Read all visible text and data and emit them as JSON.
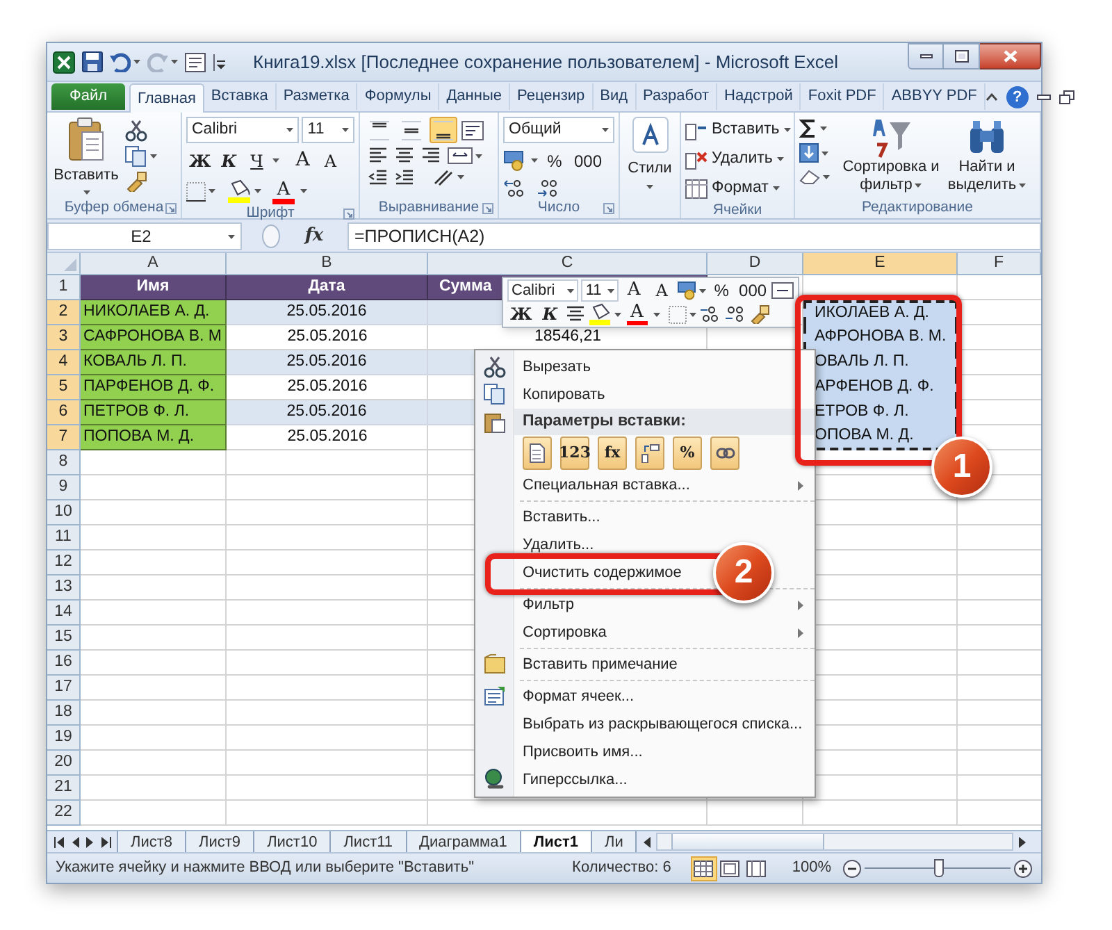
{
  "window": {
    "title": "Книга19.xlsx [Последнее сохранение пользователем]  -  Microsoft Excel"
  },
  "ribbon_tabs": [
    {
      "label": "Файл",
      "kind": "file",
      "selected": false
    },
    {
      "label": "Главная",
      "kind": "tab",
      "selected": true
    },
    {
      "label": "Вставка",
      "kind": "tab",
      "selected": false
    },
    {
      "label": "Разметка",
      "kind": "tab",
      "selected": false
    },
    {
      "label": "Формулы",
      "kind": "tab",
      "selected": false
    },
    {
      "label": "Данные",
      "kind": "tab",
      "selected": false
    },
    {
      "label": "Рецензир",
      "kind": "tab",
      "selected": false
    },
    {
      "label": "Вид",
      "kind": "tab",
      "selected": false
    },
    {
      "label": "Разработ",
      "kind": "tab",
      "selected": false
    },
    {
      "label": "Надстрой",
      "kind": "tab",
      "selected": false
    },
    {
      "label": "Foxit PDF",
      "kind": "tab",
      "selected": false
    },
    {
      "label": "ABBYY PDF",
      "kind": "tab",
      "selected": false
    }
  ],
  "help": "?",
  "clipboard": {
    "label": "Буфер обмена",
    "paste": "Вставить"
  },
  "font": {
    "label": "Шрифт",
    "name": "Calibri",
    "size": "11",
    "bold": "Ж",
    "italic": "К",
    "underline": "Ч",
    "grow": "A",
    "shrink": "A",
    "font_color": "A"
  },
  "alignment": {
    "label": "Выравнивание",
    "vertical": [
      {
        "selected": false
      },
      {
        "selected": false
      },
      {
        "selected": true
      }
    ]
  },
  "number": {
    "label": "Число",
    "format": "Общий",
    "percent": "%",
    "thousands": "000"
  },
  "styles": {
    "button": "Стили"
  },
  "cells": {
    "label": "Ячейки",
    "items": [
      "Вставить",
      "Удалить",
      "Формат"
    ]
  },
  "editing": {
    "label": "Редактирование",
    "sort": "Сортировка и фильтр",
    "find": "Найти и выделить"
  },
  "formula_bar": {
    "name_box": "E2",
    "fx": "fx",
    "formula": "=ПРОПИСН(A2)"
  },
  "sheet": {
    "columns": [
      {
        "label": "A",
        "selected": false
      },
      {
        "label": "B",
        "selected": false
      },
      {
        "label": "C",
        "selected": false
      },
      {
        "label": "D",
        "selected": false
      },
      {
        "label": "E",
        "selected": true
      },
      {
        "label": "F",
        "selected": false
      }
    ],
    "rows": [
      {
        "number": "1",
        "kind": "header",
        "selected": false,
        "a": "Имя",
        "b": "Дата",
        "c": "Сумма"
      },
      {
        "number": "2",
        "kind": "data",
        "selected": true,
        "a": "НИКОЛАЕВ А. Д.",
        "b": "25.05.2016",
        "e": "ИКОЛАЕВ А. Д."
      },
      {
        "number": "3",
        "kind": "data",
        "selected": true,
        "a": "САФРОНОВА В. М",
        "b": "25.05.2016",
        "c": "18546,21",
        "e": "АФРОНОВА В. М."
      },
      {
        "number": "4",
        "kind": "data",
        "selected": true,
        "a": "КОВАЛЬ Л. П.",
        "b": "25.05.2016",
        "e": "ОВАЛЬ Л. П."
      },
      {
        "number": "5",
        "kind": "data",
        "selected": true,
        "a": "ПАРФЕНОВ Д. Ф.",
        "b": "25.05.2016",
        "e": "АРФЕНОВ Д. Ф."
      },
      {
        "number": "6",
        "kind": "data",
        "selected": true,
        "a": "ПЕТРОВ Ф. Л.",
        "b": "25.05.2016",
        "e": "ЕТРОВ Ф. Л."
      },
      {
        "number": "7",
        "kind": "data",
        "selected": true,
        "a": "ПОПОВА М. Д.",
        "b": "25.05.2016",
        "e": "ОПОВА М. Д."
      },
      {
        "number": "8",
        "kind": "empty",
        "selected": false
      },
      {
        "number": "9",
        "kind": "empty",
        "selected": false
      },
      {
        "number": "10",
        "kind": "empty",
        "selected": false
      },
      {
        "number": "11",
        "kind": "empty",
        "selected": false
      },
      {
        "number": "12",
        "kind": "empty",
        "selected": false
      },
      {
        "number": "13",
        "kind": "empty",
        "selected": false
      },
      {
        "number": "14",
        "kind": "empty",
        "selected": false
      },
      {
        "number": "15",
        "kind": "empty",
        "selected": false
      },
      {
        "number": "16",
        "kind": "empty",
        "selected": false
      },
      {
        "number": "17",
        "kind": "empty",
        "selected": false
      },
      {
        "number": "18",
        "kind": "empty",
        "selected": false
      },
      {
        "number": "19",
        "kind": "empty",
        "selected": false
      },
      {
        "number": "20",
        "kind": "empty",
        "selected": false
      },
      {
        "number": "21",
        "kind": "empty",
        "selected": false
      },
      {
        "number": "22",
        "kind": "empty",
        "selected": false
      }
    ]
  },
  "mini_toolbar": {
    "font": "Calibri",
    "size": "11",
    "grow": "A",
    "shrink": "A",
    "percent": "%",
    "thousands": "000",
    "bold": "Ж",
    "italic": "К",
    "font_color": "A"
  },
  "context_menu": {
    "items": [
      {
        "kind": "item",
        "label": "Вырезать",
        "submenu": false
      },
      {
        "kind": "item",
        "label": "Копировать",
        "submenu": false
      },
      {
        "kind": "section",
        "label": "Параметры вставки:"
      },
      {
        "kind": "paste_options",
        "options": [
          {
            "kind": "plain"
          },
          {
            "kind": "text",
            "label": "123"
          },
          {
            "kind": "text",
            "label": "fx"
          },
          {
            "kind": "transpose"
          },
          {
            "kind": "text",
            "label": "%"
          },
          {
            "kind": "link"
          }
        ]
      },
      {
        "kind": "item",
        "label": "Специальная вставка...",
        "submenu": true
      },
      {
        "kind": "separator"
      },
      {
        "kind": "item",
        "label": "Вставить...",
        "submenu": false
      },
      {
        "kind": "item",
        "label": "Удалить...",
        "submenu": false
      },
      {
        "kind": "item",
        "label": "Очистить содержимое",
        "submenu": false
      },
      {
        "kind": "separator"
      },
      {
        "kind": "item",
        "label": "Фильтр",
        "submenu": true
      },
      {
        "kind": "item",
        "label": "Сортировка",
        "submenu": true
      },
      {
        "kind": "separator"
      },
      {
        "kind": "item",
        "label": "Вставить примечание",
        "submenu": false
      },
      {
        "kind": "separator"
      },
      {
        "kind": "item",
        "label": "Формат ячеек...",
        "submenu": false
      },
      {
        "kind": "item",
        "label": "Выбрать из раскрывающегося списка...",
        "submenu": false
      },
      {
        "kind": "item",
        "label": "Присвоить имя...",
        "submenu": false
      },
      {
        "kind": "item",
        "label": "Гиперссылка...",
        "submenu": false
      }
    ]
  },
  "callouts": [
    {
      "label": "1"
    },
    {
      "label": "2"
    }
  ],
  "sheet_tabs": [
    {
      "label": "Лист8",
      "selected": false
    },
    {
      "label": "Лист9",
      "selected": false
    },
    {
      "label": "Лист10",
      "selected": false
    },
    {
      "label": "Лист11",
      "selected": false
    },
    {
      "label": "Диаграмма1",
      "selected": false
    },
    {
      "label": "Лист1",
      "selected": true
    },
    {
      "label": "Ли",
      "selected": false
    }
  ],
  "status_bar": {
    "message": "Укажите ячейку и нажмите ВВОД или выберите \"Вставить\"",
    "count": "Количество: 6",
    "views": [
      {
        "selected": true
      },
      {
        "selected": false
      },
      {
        "selected": false
      }
    ],
    "zoom": "100%",
    "zoom_slider": {
      "level": 0.5
    }
  }
}
